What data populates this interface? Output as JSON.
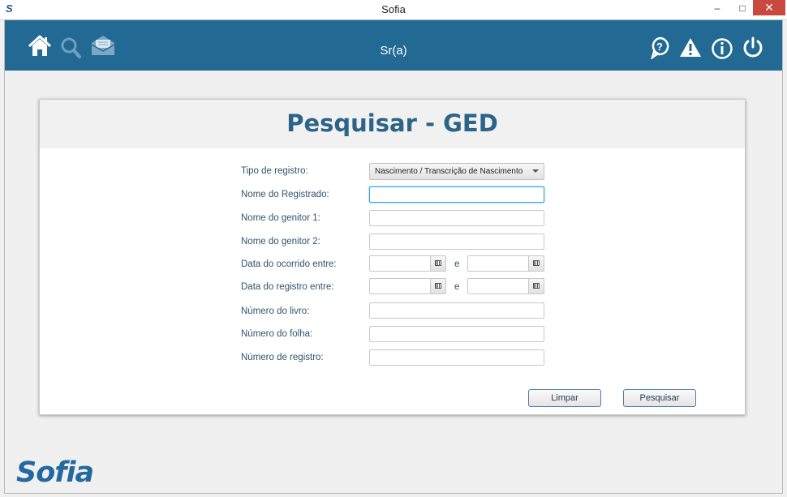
{
  "window": {
    "title": "Sofia",
    "app_icon": "S",
    "min": "–",
    "max": "□",
    "close": "✕"
  },
  "header": {
    "user_label": "Sr(a)",
    "left_icons": [
      "home-icon",
      "search-icon",
      "mail-icon"
    ],
    "right_icons": [
      "help-icon",
      "warning-icon",
      "info-icon",
      "power-icon"
    ],
    "color": "#226994"
  },
  "panel": {
    "title": "Pesquisar - GED",
    "labels": {
      "tipo": "Tipo de registro:",
      "nome": "Nome do Registrado:",
      "genitor1": "Nome do genitor 1:",
      "genitor2": "Nome do genitor 2:",
      "ocorrido": "Data do ocorrido entre:",
      "registro": "Data do registro entre:",
      "livro": "Número do livro:",
      "folha": "Número do folha:",
      "numero": "Número de registro:"
    },
    "tipo_value": "Nascimento / Transcrição de Nascimento",
    "between": "e",
    "buttons": {
      "limpar": "Limpar",
      "pesquisar": "Pesquisar"
    }
  },
  "logo": {
    "text": "Sofia"
  }
}
